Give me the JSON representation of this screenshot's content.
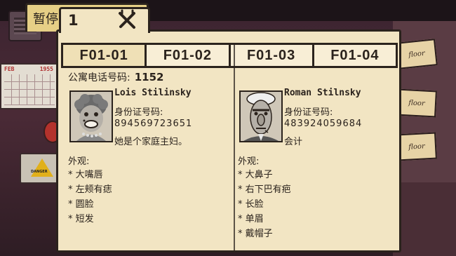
{
  "window": {
    "pause_label": "暂停",
    "tab_number": "1",
    "close_icon": "close-x-icon"
  },
  "background": {
    "calendar_month": "FEB",
    "calendar_year": "1955",
    "sign_text": "DANGER",
    "notes": [
      "floor",
      "floor",
      "floor"
    ]
  },
  "tabs": [
    {
      "label": "F01-01",
      "active": true
    },
    {
      "label": "F01-02",
      "active": false
    },
    {
      "label": "F01-03",
      "active": false
    },
    {
      "label": "F01-04",
      "active": false
    }
  ],
  "apartment": {
    "phone_label": "公寓电话号码:",
    "phone_number": "1152"
  },
  "residents": [
    {
      "name": "Lois Stilinsky",
      "id_label": "身份证号码:",
      "id_number": "894569723651",
      "occupation": "她是个家庭主妇。",
      "appearance_label": "外观:",
      "traits": [
        "* 大嘴唇",
        "* 左颊有痣",
        "* 圆脸",
        "* 短发"
      ],
      "portrait_icon": "woman-portrait-icon"
    },
    {
      "name": "Roman Stilnsky",
      "id_label": "身份证号码:",
      "id_number": "483924059684",
      "occupation": "会计",
      "appearance_label": "外观:",
      "traits": [
        "* 大鼻子",
        "* 右下巴有疤",
        "* 长脸",
        "* 单眉",
        "* 戴帽子"
      ],
      "portrait_icon": "man-portrait-icon"
    }
  ],
  "colors": {
    "paper": "#f2e5c3",
    "ink": "#2b231d",
    "tab_yellow": "#e6cf86"
  }
}
